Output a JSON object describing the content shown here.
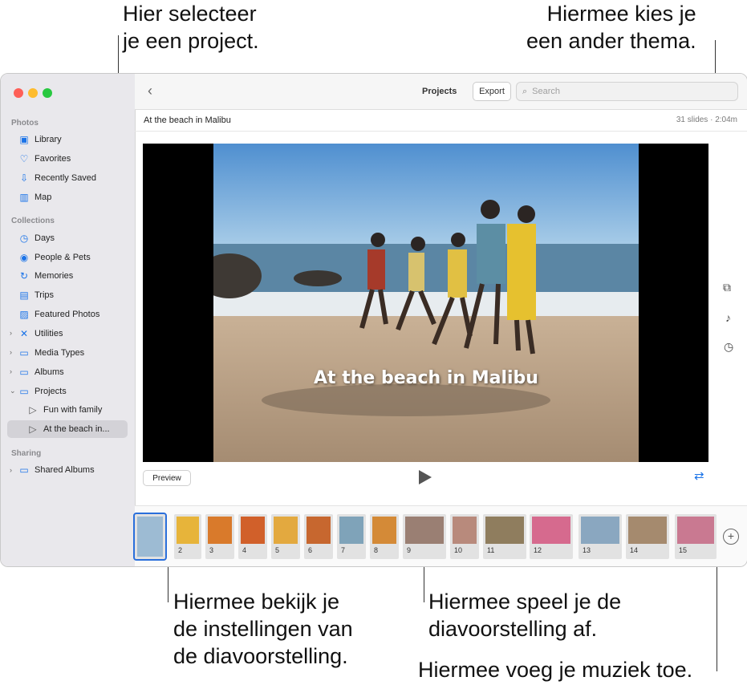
{
  "callouts": {
    "top_left": "Hier selecteer\nje een project.",
    "top_right": "Hiermee kies je\neen ander thema.",
    "bottom_preview": "Hiermee bekijk je\nde instellingen van\nde diavoorstelling.",
    "bottom_play": "Hiermee speel je de\ndiavoorstelling af.",
    "bottom_music": "Hiermee voeg je muziek toe."
  },
  "sidebar": {
    "photos_header": "Photos",
    "collections_header": "Collections",
    "sharing_header": "Sharing",
    "items": {
      "library": "Library",
      "favorites": "Favorites",
      "recently_saved": "Recently Saved",
      "map": "Map",
      "days": "Days",
      "people_pets": "People & Pets",
      "memories": "Memories",
      "trips": "Trips",
      "featured": "Featured Photos",
      "utilities": "Utilities",
      "media_types": "Media Types",
      "albums": "Albums",
      "projects": "Projects",
      "fun_with_family": "Fun with family",
      "at_the_beach": "At the beach in...",
      "shared_albums": "Shared Albums"
    }
  },
  "toolbar": {
    "title": "Projects",
    "export": "Export",
    "search_placeholder": "Search"
  },
  "project": {
    "title": "At the beach in Malibu",
    "meta": "31 slides · 2:04m",
    "slide_title": "At the beach in Malibu"
  },
  "controls": {
    "preview": "Preview"
  },
  "thumbnails": [
    "",
    "2",
    "3",
    "4",
    "5",
    "6",
    "7",
    "8",
    "9",
    "10",
    "11",
    "12",
    "13",
    "14",
    "15"
  ],
  "colors": {
    "accent": "#1a73e8",
    "sidebar_bg": "#e9e8ec"
  }
}
